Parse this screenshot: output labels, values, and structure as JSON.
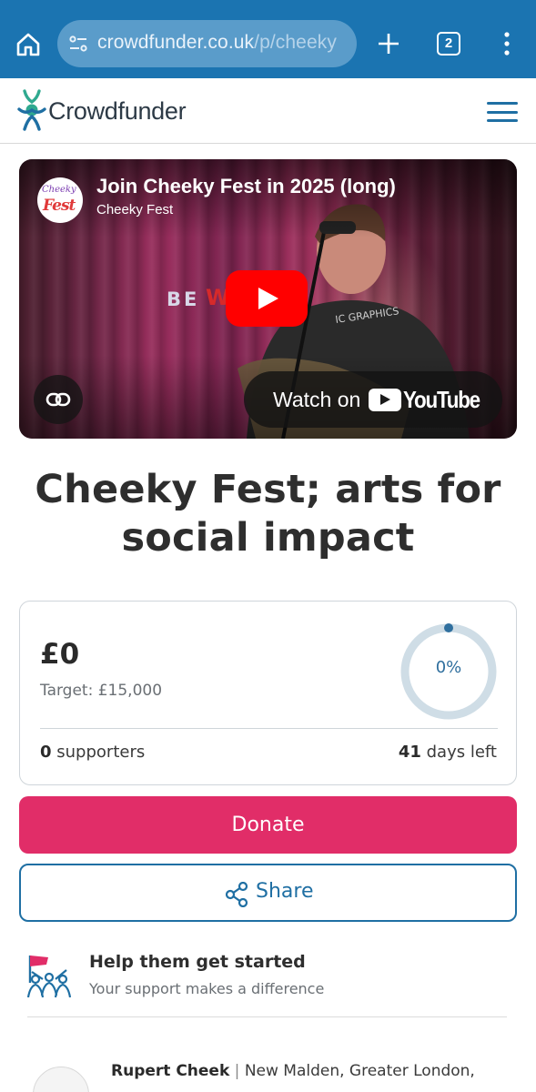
{
  "browser": {
    "url_main": "crowdfunder.co.uk",
    "url_path": "/p/cheeky",
    "tab_count": "2",
    "toolbar_color": "#1b74b1"
  },
  "site": {
    "logo_text": "Crowdfunder",
    "brand_color": "#1f6fa3",
    "logo_accent": "#2fa98f"
  },
  "video": {
    "title": "Join Cheeky Fest in 2025 (long)",
    "channel": "Cheeky Fest",
    "avatar_line1": "Cheeky",
    "avatar_line2": "Fest",
    "overlay_be": "BE",
    "overlay_wome": "W",
    "watch_on": "Watch on",
    "youtube": "YouTube"
  },
  "project": {
    "title": "Cheeky Fest; arts for social impact"
  },
  "stats": {
    "raised": "£0",
    "target": "Target: £15,000",
    "percent_label": "0%",
    "progress_fraction": 0,
    "supporters_count": "0",
    "supporters_label": "supporters",
    "days_count": "41",
    "days_label": "days left",
    "ring_color": "#cfdde6",
    "ring_dot_color": "#2f6f9e"
  },
  "actions": {
    "donate_label": "Donate",
    "donate_color": "#e12d68",
    "share_label": "Share"
  },
  "help": {
    "title": "Help them get started",
    "subtitle": "Your support makes a difference"
  },
  "owner": {
    "name": "Rupert Cheek",
    "separator": "|",
    "location": "New Malden, Greater London,"
  }
}
